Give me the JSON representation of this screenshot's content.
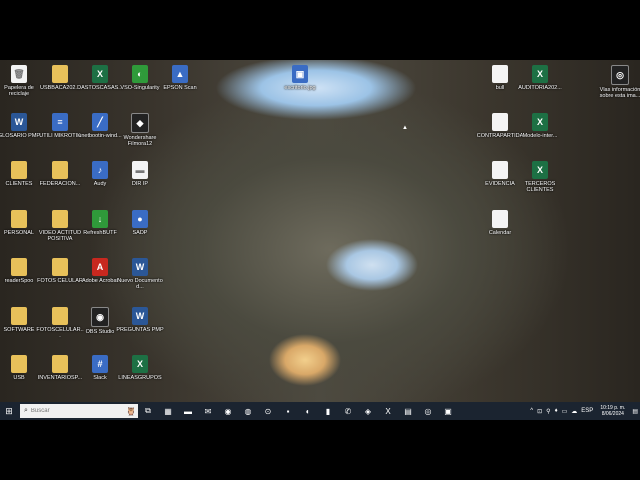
{
  "desktop": {
    "icons": [
      {
        "label": "Papelera de reciclaje",
        "glyph": "🗑",
        "kind": "doc"
      },
      {
        "label": "USBBACA202...",
        "glyph": "",
        "kind": "folder"
      },
      {
        "label": "DASTOSCASAS...",
        "glyph": "X",
        "kind": "excel"
      },
      {
        "label": "VSO-Singularity",
        "glyph": "◐",
        "kind": "green"
      },
      {
        "label": "EPSON Scan",
        "glyph": "▲",
        "kind": "app"
      },
      {
        "label": "GLOSARIO PMP",
        "glyph": "W",
        "kind": "word"
      },
      {
        "label": "UTILI MIKROTIK",
        "glyph": "≡",
        "kind": "app"
      },
      {
        "label": "unetbootin-wind...",
        "glyph": "╱",
        "kind": "app"
      },
      {
        "label": "Wondershare Filmora12",
        "glyph": "◆",
        "kind": "dark"
      },
      {
        "label": "CLIENTES",
        "glyph": "",
        "kind": "folder"
      },
      {
        "label": "FEDERACION...",
        "glyph": "",
        "kind": "folder"
      },
      {
        "label": "Audy",
        "glyph": "♪",
        "kind": "app"
      },
      {
        "label": "DIR IP",
        "glyph": "▬",
        "kind": "doc"
      },
      {
        "label": "PERSONAL",
        "glyph": "",
        "kind": "folder"
      },
      {
        "label": "VIDEO ACTITUD POSITIVA",
        "glyph": "",
        "kind": "folder"
      },
      {
        "label": "RefreshBUTF",
        "glyph": "↓",
        "kind": "green"
      },
      {
        "label": "SADP",
        "glyph": "●",
        "kind": "app"
      },
      {
        "label": "readerSpoo",
        "glyph": "",
        "kind": "folder"
      },
      {
        "label": "FOTOS CELULAR",
        "glyph": "",
        "kind": "folder"
      },
      {
        "label": "Adobe Acrobat",
        "glyph": "A",
        "kind": "red"
      },
      {
        "label": "Nuevo Documento d...",
        "glyph": "W",
        "kind": "word"
      },
      {
        "label": "SOFTWARE",
        "glyph": "",
        "kind": "folder"
      },
      {
        "label": "FOTOSCELULAR...",
        "glyph": "",
        "kind": "folder"
      },
      {
        "label": "OBS Studio",
        "glyph": "◉",
        "kind": "dark"
      },
      {
        "label": "PREGUNTAS PMP",
        "glyph": "W",
        "kind": "word"
      },
      {
        "label": "USB",
        "glyph": "",
        "kind": "folder"
      },
      {
        "label": "INVENTARIOSP...",
        "glyph": "",
        "kind": "folder"
      },
      {
        "label": "Slack",
        "glyph": "#",
        "kind": "app"
      },
      {
        "label": "LINEASGRUPOS",
        "glyph": "X",
        "kind": "excel"
      },
      {
        "label": "escritorio.jpg",
        "glyph": "▣",
        "kind": "app"
      },
      {
        "label": "bull",
        "glyph": "",
        "kind": "doc"
      },
      {
        "label": "AUDITORIA202...",
        "glyph": "X",
        "kind": "excel"
      },
      {
        "label": "Vlas información sobre esta ima...",
        "glyph": "◎",
        "kind": "dark"
      },
      {
        "label": "CONTRAPARTIDA",
        "glyph": "",
        "kind": "doc"
      },
      {
        "label": "Modelo-inter...",
        "glyph": "X",
        "kind": "excel"
      },
      {
        "label": "EVIDENCIA",
        "glyph": "",
        "kind": "doc"
      },
      {
        "label": "TERCEROS CLIENTES",
        "glyph": "X",
        "kind": "excel"
      },
      {
        "label": "Calendar",
        "glyph": "",
        "kind": "doc"
      }
    ]
  },
  "taskbar": {
    "start_glyph": "⊞",
    "search_glyph": "⌕",
    "search_placeholder": "Buscar",
    "owl_glyph": "🦉",
    "pinned": [
      {
        "glyph": "⧉",
        "name": "task-view"
      },
      {
        "glyph": "▦",
        "name": "app-1"
      },
      {
        "glyph": "▬",
        "name": "file-explorer"
      },
      {
        "glyph": "✉",
        "name": "mail"
      },
      {
        "glyph": "◉",
        "name": "firefox"
      },
      {
        "glyph": "◍",
        "name": "edge"
      },
      {
        "glyph": "⊙",
        "name": "chrome"
      },
      {
        "glyph": "▪",
        "name": "app-2"
      },
      {
        "glyph": "◐",
        "name": "app-3"
      },
      {
        "glyph": "▮",
        "name": "app-4"
      },
      {
        "glyph": "✆",
        "name": "whatsapp"
      },
      {
        "glyph": "◈",
        "name": "app-5"
      },
      {
        "glyph": "X",
        "name": "excel"
      },
      {
        "glyph": "▤",
        "name": "app-6"
      },
      {
        "glyph": "◎",
        "name": "app-7"
      },
      {
        "glyph": "▣",
        "name": "app-8"
      }
    ],
    "tray": {
      "chevron": "^",
      "icons": [
        "⊡",
        "⚲",
        "♦",
        "▭",
        "☁"
      ],
      "language": "ESP",
      "time": "10:19 p. m.",
      "date": "8/06/2024",
      "notify": "▤"
    }
  }
}
